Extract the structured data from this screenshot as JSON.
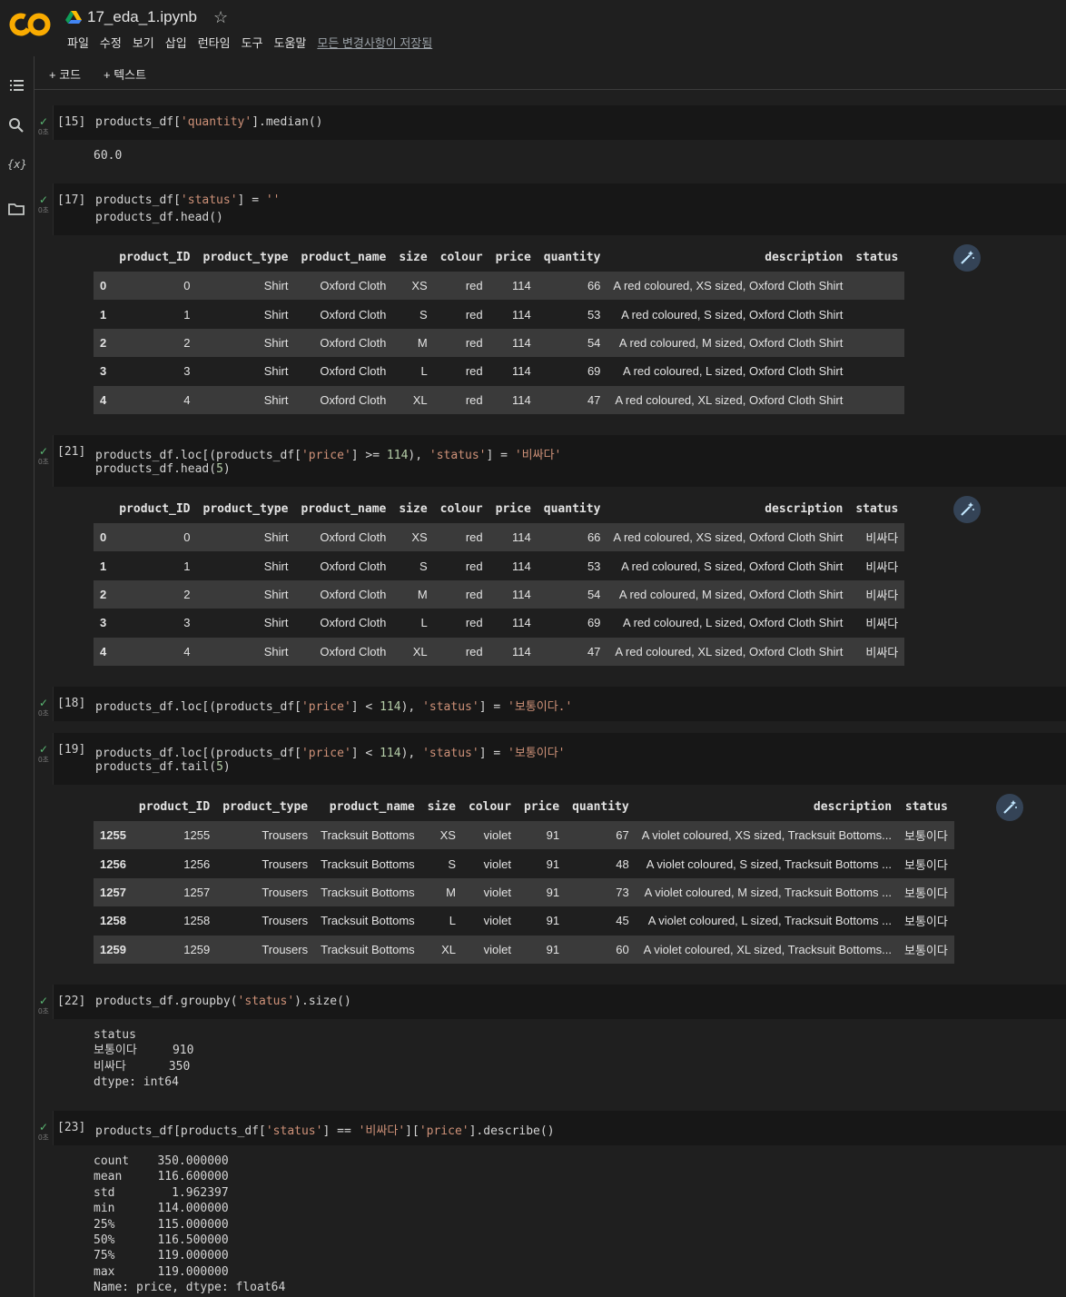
{
  "app": {
    "logo_text": "CO",
    "notebook_title": "17_eda_1.ipynb",
    "menu": [
      "파일",
      "수정",
      "보기",
      "삽입",
      "런타임",
      "도구",
      "도움말"
    ],
    "save_status": "모든 변경사항이 저장됨"
  },
  "toolbar": {
    "add_code": "+ 코드",
    "add_text": "+ 텍스트"
  },
  "exec_time_label": "0초",
  "cells": {
    "c15": {
      "prompt": "[15]",
      "output": "60.0"
    },
    "c17": {
      "prompt": "[17]"
    },
    "c21": {
      "prompt": "[21]"
    },
    "c18": {
      "prompt": "[18]"
    },
    "c19": {
      "prompt": "[19]"
    },
    "c22": {
      "prompt": "[22]",
      "output": "status\n보통이다     910\n비싸다      350\ndtype: int64"
    },
    "c23": {
      "prompt": "[23]",
      "output": "count    350.000000\nmean     116.600000\nstd        1.962397\nmin      114.000000\n25%      115.000000\n50%      116.500000\n75%      119.000000\nmax      119.000000\nName: price, dtype: float64"
    }
  },
  "table_columns": [
    "",
    "product_ID",
    "product_type",
    "product_name",
    "size",
    "colour",
    "price",
    "quantity",
    "description",
    "status"
  ],
  "table17": [
    [
      "0",
      "0",
      "Shirt",
      "Oxford Cloth",
      "XS",
      "red",
      "114",
      "66",
      "A red coloured, XS sized, Oxford Cloth Shirt",
      ""
    ],
    [
      "1",
      "1",
      "Shirt",
      "Oxford Cloth",
      "S",
      "red",
      "114",
      "53",
      "A red coloured, S sized, Oxford Cloth Shirt",
      ""
    ],
    [
      "2",
      "2",
      "Shirt",
      "Oxford Cloth",
      "M",
      "red",
      "114",
      "54",
      "A red coloured, M sized, Oxford Cloth Shirt",
      ""
    ],
    [
      "3",
      "3",
      "Shirt",
      "Oxford Cloth",
      "L",
      "red",
      "114",
      "69",
      "A red coloured, L sized, Oxford Cloth Shirt",
      ""
    ],
    [
      "4",
      "4",
      "Shirt",
      "Oxford Cloth",
      "XL",
      "red",
      "114",
      "47",
      "A red coloured, XL sized, Oxford Cloth Shirt",
      ""
    ]
  ],
  "table21": [
    [
      "0",
      "0",
      "Shirt",
      "Oxford Cloth",
      "XS",
      "red",
      "114",
      "66",
      "A red coloured, XS sized, Oxford Cloth Shirt",
      "비싸다"
    ],
    [
      "1",
      "1",
      "Shirt",
      "Oxford Cloth",
      "S",
      "red",
      "114",
      "53",
      "A red coloured, S sized, Oxford Cloth Shirt",
      "비싸다"
    ],
    [
      "2",
      "2",
      "Shirt",
      "Oxford Cloth",
      "M",
      "red",
      "114",
      "54",
      "A red coloured, M sized, Oxford Cloth Shirt",
      "비싸다"
    ],
    [
      "3",
      "3",
      "Shirt",
      "Oxford Cloth",
      "L",
      "red",
      "114",
      "69",
      "A red coloured, L sized, Oxford Cloth Shirt",
      "비싸다"
    ],
    [
      "4",
      "4",
      "Shirt",
      "Oxford Cloth",
      "XL",
      "red",
      "114",
      "47",
      "A red coloured, XL sized, Oxford Cloth Shirt",
      "비싸다"
    ]
  ],
  "table19": [
    [
      "1255",
      "1255",
      "Trousers",
      "Tracksuit Bottoms",
      "XS",
      "violet",
      "91",
      "67",
      "A violet coloured, XS sized, Tracksuit Bottoms...",
      "보통이다"
    ],
    [
      "1256",
      "1256",
      "Trousers",
      "Tracksuit Bottoms",
      "S",
      "violet",
      "91",
      "48",
      "A violet coloured, S sized, Tracksuit Bottoms ...",
      "보통이다"
    ],
    [
      "1257",
      "1257",
      "Trousers",
      "Tracksuit Bottoms",
      "M",
      "violet",
      "91",
      "73",
      "A violet coloured, M sized, Tracksuit Bottoms ...",
      "보통이다"
    ],
    [
      "1258",
      "1258",
      "Trousers",
      "Tracksuit Bottoms",
      "L",
      "violet",
      "91",
      "45",
      "A violet coloured, L sized, Tracksuit Bottoms ...",
      "보통이다"
    ],
    [
      "1259",
      "1259",
      "Trousers",
      "Tracksuit Bottoms",
      "XL",
      "violet",
      "91",
      "60",
      "A violet coloured, XL sized, Tracksuit Bottoms...",
      "보통이다"
    ]
  ]
}
